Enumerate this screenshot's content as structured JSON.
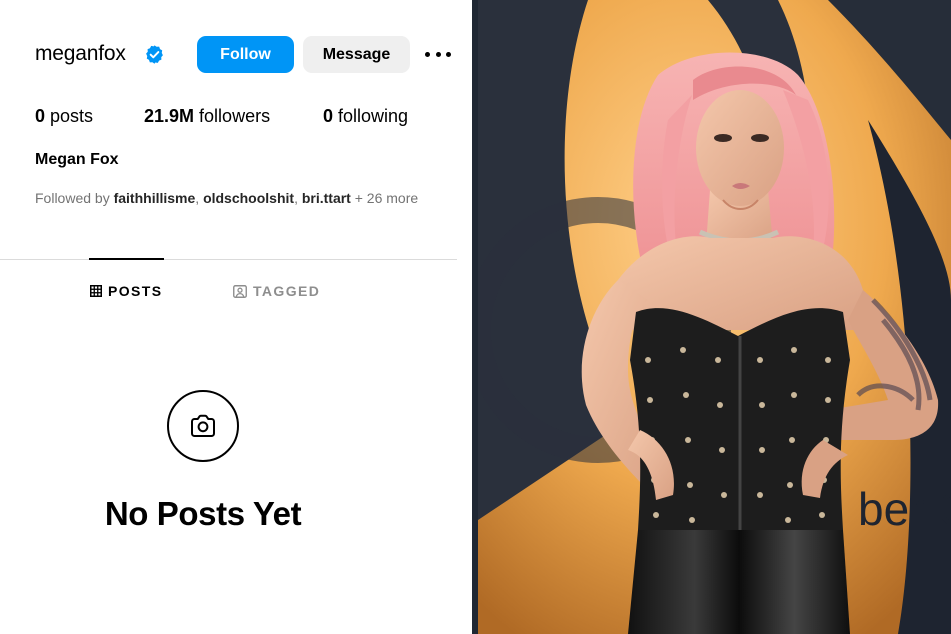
{
  "profile": {
    "username": "meganfox",
    "verified": true,
    "full_name": "Megan Fox",
    "actions": {
      "follow_label": "Follow",
      "message_label": "Message"
    },
    "stats": {
      "posts_count": "0",
      "posts_label": "posts",
      "followers_count": "21.9M",
      "followers_label": "followers",
      "following_count": "0",
      "following_label": "following"
    },
    "followed_by": {
      "prefix": "Followed by",
      "users": [
        "faithhillisme",
        "oldschoolshit",
        "bri.ttart"
      ],
      "more": "+ 26 more"
    }
  },
  "tabs": [
    {
      "label": "POSTS",
      "icon": "grid-icon",
      "active": true
    },
    {
      "label": "TAGGED",
      "icon": "tagged-icon",
      "active": false
    }
  ],
  "empty_state": {
    "icon": "camera-icon",
    "text": "No Posts Yet"
  },
  "photo": {
    "backdrop_partial_text": "ber C"
  },
  "colors": {
    "accent": "#0095f6",
    "verified_badge": "#0095f6",
    "secondary_text": "#737373",
    "inactive_tab": "#8e8e8e",
    "photo_backdrop_gold": "#e8a24a",
    "photo_backdrop_dark": "#1c2330",
    "hair": "#f2a2a4"
  }
}
